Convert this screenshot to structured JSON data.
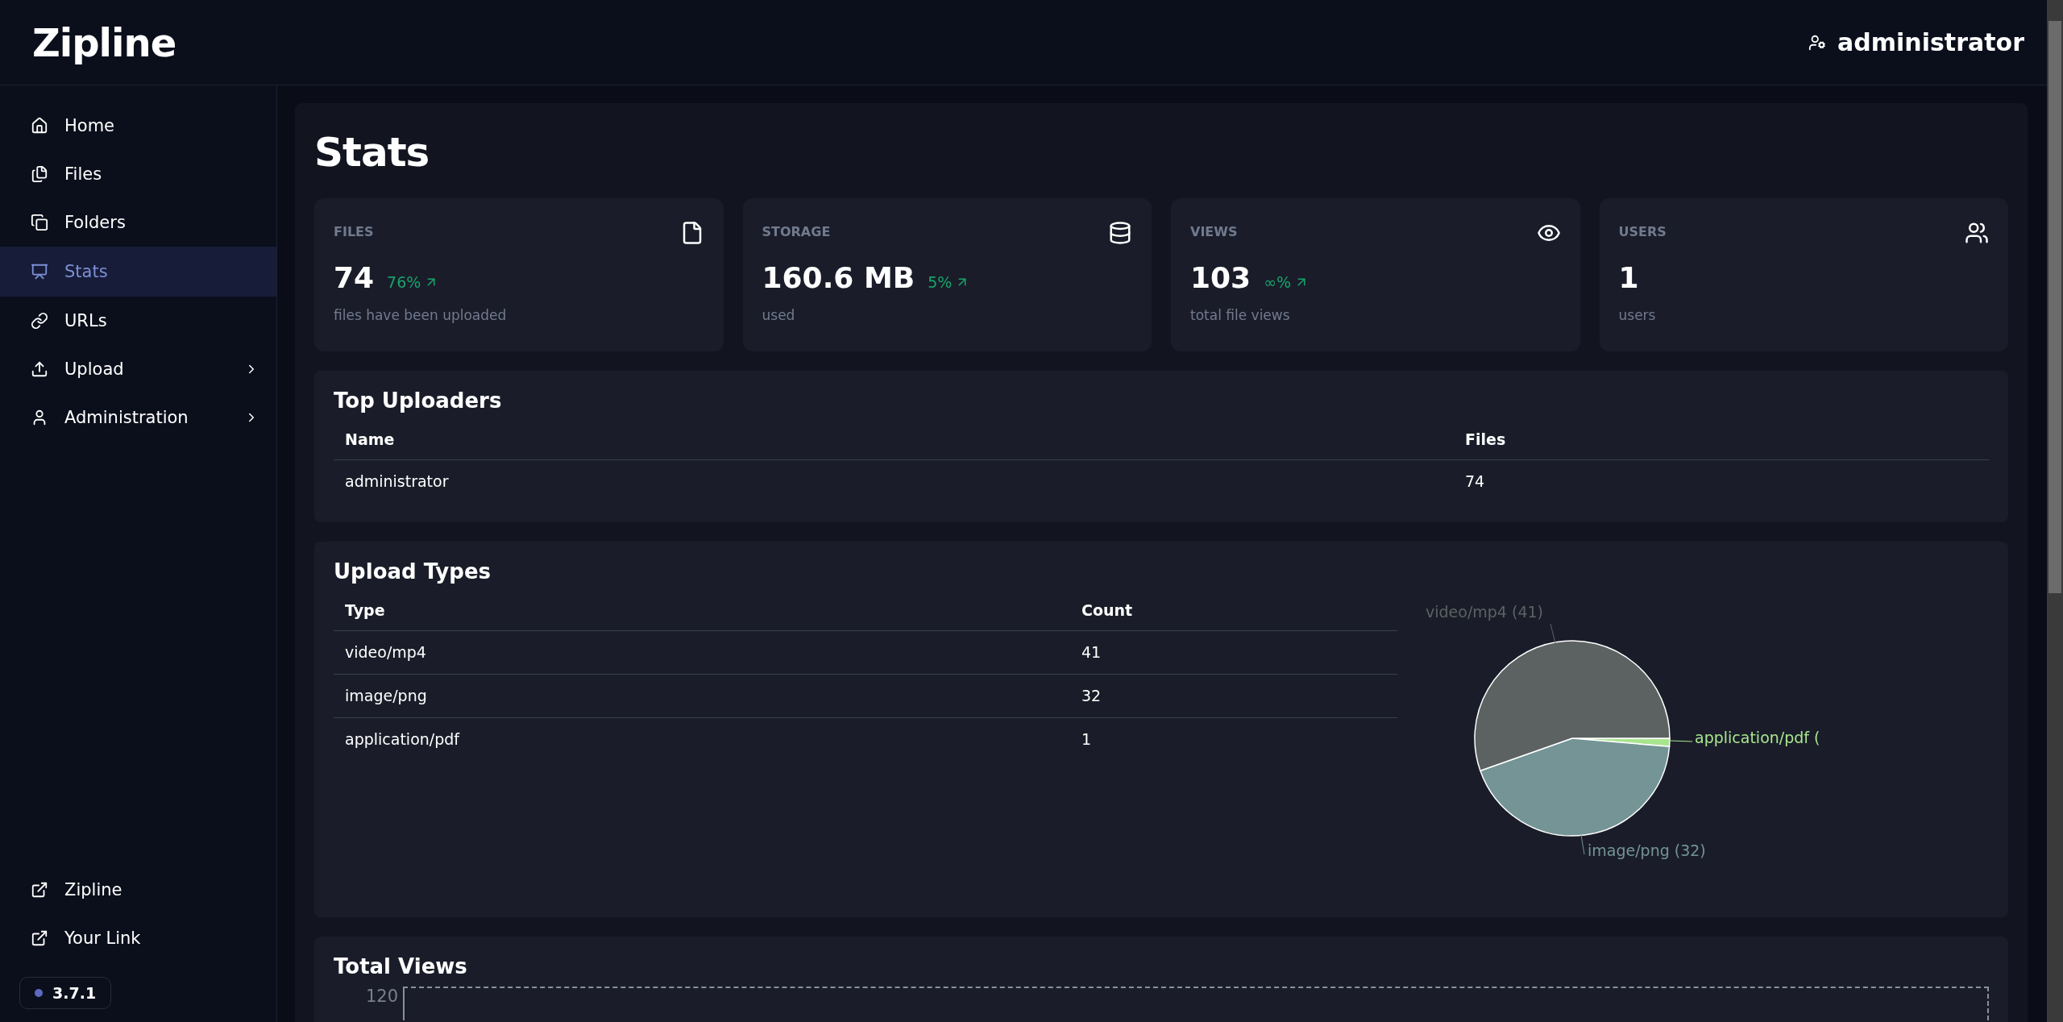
{
  "header": {
    "logo": "Zipline",
    "user": "administrator"
  },
  "sidebar": {
    "items": [
      {
        "label": "Home",
        "kind": "home",
        "selected": false,
        "expandable": false
      },
      {
        "label": "Files",
        "kind": "files",
        "selected": false,
        "expandable": false
      },
      {
        "label": "Folders",
        "kind": "folders",
        "selected": false,
        "expandable": false
      },
      {
        "label": "Stats",
        "kind": "stats",
        "selected": true,
        "expandable": false
      },
      {
        "label": "URLs",
        "kind": "link",
        "selected": false,
        "expandable": false
      },
      {
        "label": "Upload",
        "kind": "upload",
        "selected": false,
        "expandable": true
      },
      {
        "label": "Administration",
        "kind": "user",
        "selected": false,
        "expandable": true
      }
    ],
    "footer_links": [
      {
        "label": "Zipline"
      },
      {
        "label": "Your Link"
      }
    ],
    "version": "3.7.1"
  },
  "page": {
    "title": "Stats"
  },
  "cards": [
    {
      "label": "FILES",
      "kind": "file",
      "value": "74",
      "change": "76%",
      "caption": "files have been uploaded"
    },
    {
      "label": "STORAGE",
      "kind": "database",
      "value": "160.6 MB",
      "change": "5%",
      "caption": "used"
    },
    {
      "label": "VIEWS",
      "kind": "eye",
      "value": "103",
      "change": "∞%",
      "caption": "total file views"
    },
    {
      "label": "USERS",
      "kind": "users",
      "value": "1",
      "caption": "users"
    }
  ],
  "top_uploaders": {
    "title": "Top Uploaders",
    "columns": [
      "Name",
      "Files"
    ],
    "rows": [
      [
        "administrator",
        "74"
      ]
    ]
  },
  "upload_types": {
    "title": "Upload Types",
    "columns": [
      "Type",
      "Count"
    ],
    "rows": [
      [
        "video/mp4",
        "41"
      ],
      [
        "image/png",
        "32"
      ],
      [
        "application/pdf",
        "1"
      ]
    ],
    "chart_data": {
      "type": "pie",
      "categories": [
        "video/mp4 (41)",
        "image/png (32)",
        "application/pdf ("
      ],
      "values": [
        41,
        32,
        1
      ],
      "colors": [
        "#5c6262",
        "#749496",
        "#a9e58f"
      ]
    }
  },
  "total_views": {
    "title": "Total Views",
    "y_tick": "120"
  }
}
